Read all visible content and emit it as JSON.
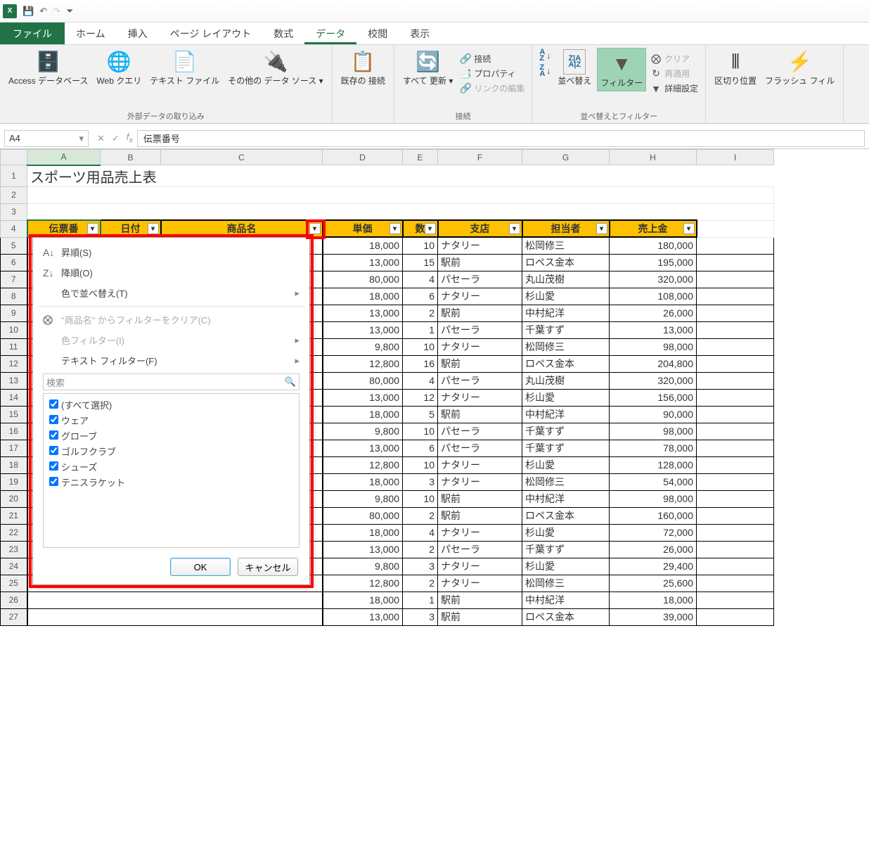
{
  "qat": {
    "undo": "↶",
    "redo": "↷"
  },
  "tabs": {
    "file": "ファイル",
    "home": "ホーム",
    "insert": "挿入",
    "pagelayout": "ページ レイアウト",
    "formulas": "数式",
    "data": "データ",
    "review": "校閲",
    "view": "表示"
  },
  "ribbon": {
    "external": {
      "access": "Access\nデータベース",
      "web": "Web\nクエリ",
      "text": "テキスト\nファイル",
      "other": "その他の\nデータ ソース",
      "group": "外部データの取り込み"
    },
    "conn": {
      "existing": "既存の\n接続",
      "refresh": "すべて\n更新",
      "conn": "接続",
      "prop": "プロパティ",
      "editlinks": "リンクの編集",
      "group": "接続"
    },
    "sort": {
      "asc": "A↓Z",
      "desc": "Z↓A",
      "sort": "並べ替え",
      "filter": "フィルター",
      "clear": "クリア",
      "reapply": "再適用",
      "advanced": "詳細設定",
      "group": "並べ替えとフィルター"
    },
    "tools": {
      "texttocols": "区切り位置",
      "flashfill": "フラッシュ\nフィル"
    }
  },
  "namebox": "A4",
  "formula": "伝票番号",
  "columns": [
    "A",
    "B",
    "C",
    "D",
    "E",
    "F",
    "G",
    "H",
    "I"
  ],
  "sheet_title": "スポーツ用品売上表",
  "headers": {
    "A": "伝票番",
    "B": "日付",
    "C": "商品名",
    "D": "単価",
    "E": "数",
    "F": "支店",
    "G": "担当者",
    "H": "売上金"
  },
  "rows": [
    {
      "r": 5,
      "D": "18,000",
      "E": "10",
      "F": "ナタリー",
      "G": "松岡修三",
      "H": "180,000"
    },
    {
      "r": 6,
      "D": "13,000",
      "E": "15",
      "F": "駅前",
      "G": "ロペス金本",
      "H": "195,000"
    },
    {
      "r": 7,
      "D": "80,000",
      "E": "4",
      "F": "パセーラ",
      "G": "丸山茂樹",
      "H": "320,000"
    },
    {
      "r": 8,
      "D": "18,000",
      "E": "6",
      "F": "ナタリー",
      "G": "杉山愛",
      "H": "108,000"
    },
    {
      "r": 9,
      "D": "13,000",
      "E": "2",
      "F": "駅前",
      "G": "中村紀洋",
      "H": "26,000"
    },
    {
      "r": 10,
      "D": "13,000",
      "E": "1",
      "F": "パセーラ",
      "G": "千葉すず",
      "H": "13,000"
    },
    {
      "r": 11,
      "D": "9,800",
      "E": "10",
      "F": "ナタリー",
      "G": "松岡修三",
      "H": "98,000"
    },
    {
      "r": 12,
      "D": "12,800",
      "E": "16",
      "F": "駅前",
      "G": "ロペス金本",
      "H": "204,800"
    },
    {
      "r": 13,
      "D": "80,000",
      "E": "4",
      "F": "パセーラ",
      "G": "丸山茂樹",
      "H": "320,000"
    },
    {
      "r": 14,
      "D": "13,000",
      "E": "12",
      "F": "ナタリー",
      "G": "杉山愛",
      "H": "156,000"
    },
    {
      "r": 15,
      "D": "18,000",
      "E": "5",
      "F": "駅前",
      "G": "中村紀洋",
      "H": "90,000"
    },
    {
      "r": 16,
      "D": "9,800",
      "E": "10",
      "F": "パセーラ",
      "G": "千葉すず",
      "H": "98,000"
    },
    {
      "r": 17,
      "D": "13,000",
      "E": "6",
      "F": "パセーラ",
      "G": "千葉すず",
      "H": "78,000"
    },
    {
      "r": 18,
      "D": "12,800",
      "E": "10",
      "F": "ナタリー",
      "G": "杉山愛",
      "H": "128,000"
    },
    {
      "r": 19,
      "D": "18,000",
      "E": "3",
      "F": "ナタリー",
      "G": "松岡修三",
      "H": "54,000"
    },
    {
      "r": 20,
      "D": "9,800",
      "E": "10",
      "F": "駅前",
      "G": "中村紀洋",
      "H": "98,000"
    },
    {
      "r": 21,
      "D": "80,000",
      "E": "2",
      "F": "駅前",
      "G": "ロペス金本",
      "H": "160,000"
    },
    {
      "r": 22,
      "D": "18,000",
      "E": "4",
      "F": "ナタリー",
      "G": "杉山愛",
      "H": "72,000"
    },
    {
      "r": 23,
      "D": "13,000",
      "E": "2",
      "F": "パセーラ",
      "G": "千葉すず",
      "H": "26,000"
    },
    {
      "r": 24,
      "D": "9,800",
      "E": "3",
      "F": "ナタリー",
      "G": "杉山愛",
      "H": "29,400"
    },
    {
      "r": 25,
      "D": "12,800",
      "E": "2",
      "F": "ナタリー",
      "G": "松岡修三",
      "H": "25,600"
    },
    {
      "r": 26,
      "D": "18,000",
      "E": "1",
      "F": "駅前",
      "G": "中村紀洋",
      "H": "18,000"
    },
    {
      "r": 27,
      "D": "13,000",
      "E": "3",
      "F": "駅前",
      "G": "ロペス金本",
      "H": "39,000"
    }
  ],
  "filter": {
    "asc": "昇順(S)",
    "desc": "降順(O)",
    "sortbycolor": "色で並べ替え(T)",
    "clear": "\"商品名\" からフィルターをクリア(C)",
    "filterbycolor": "色フィルター(I)",
    "textfilter": "テキスト フィルター(F)",
    "search": "検索",
    "items": [
      "(すべて選択)",
      "ウェア",
      "グローブ",
      "ゴルフクラブ",
      "シューズ",
      "テニスラケット"
    ],
    "ok": "OK",
    "cancel": "キャンセル"
  }
}
